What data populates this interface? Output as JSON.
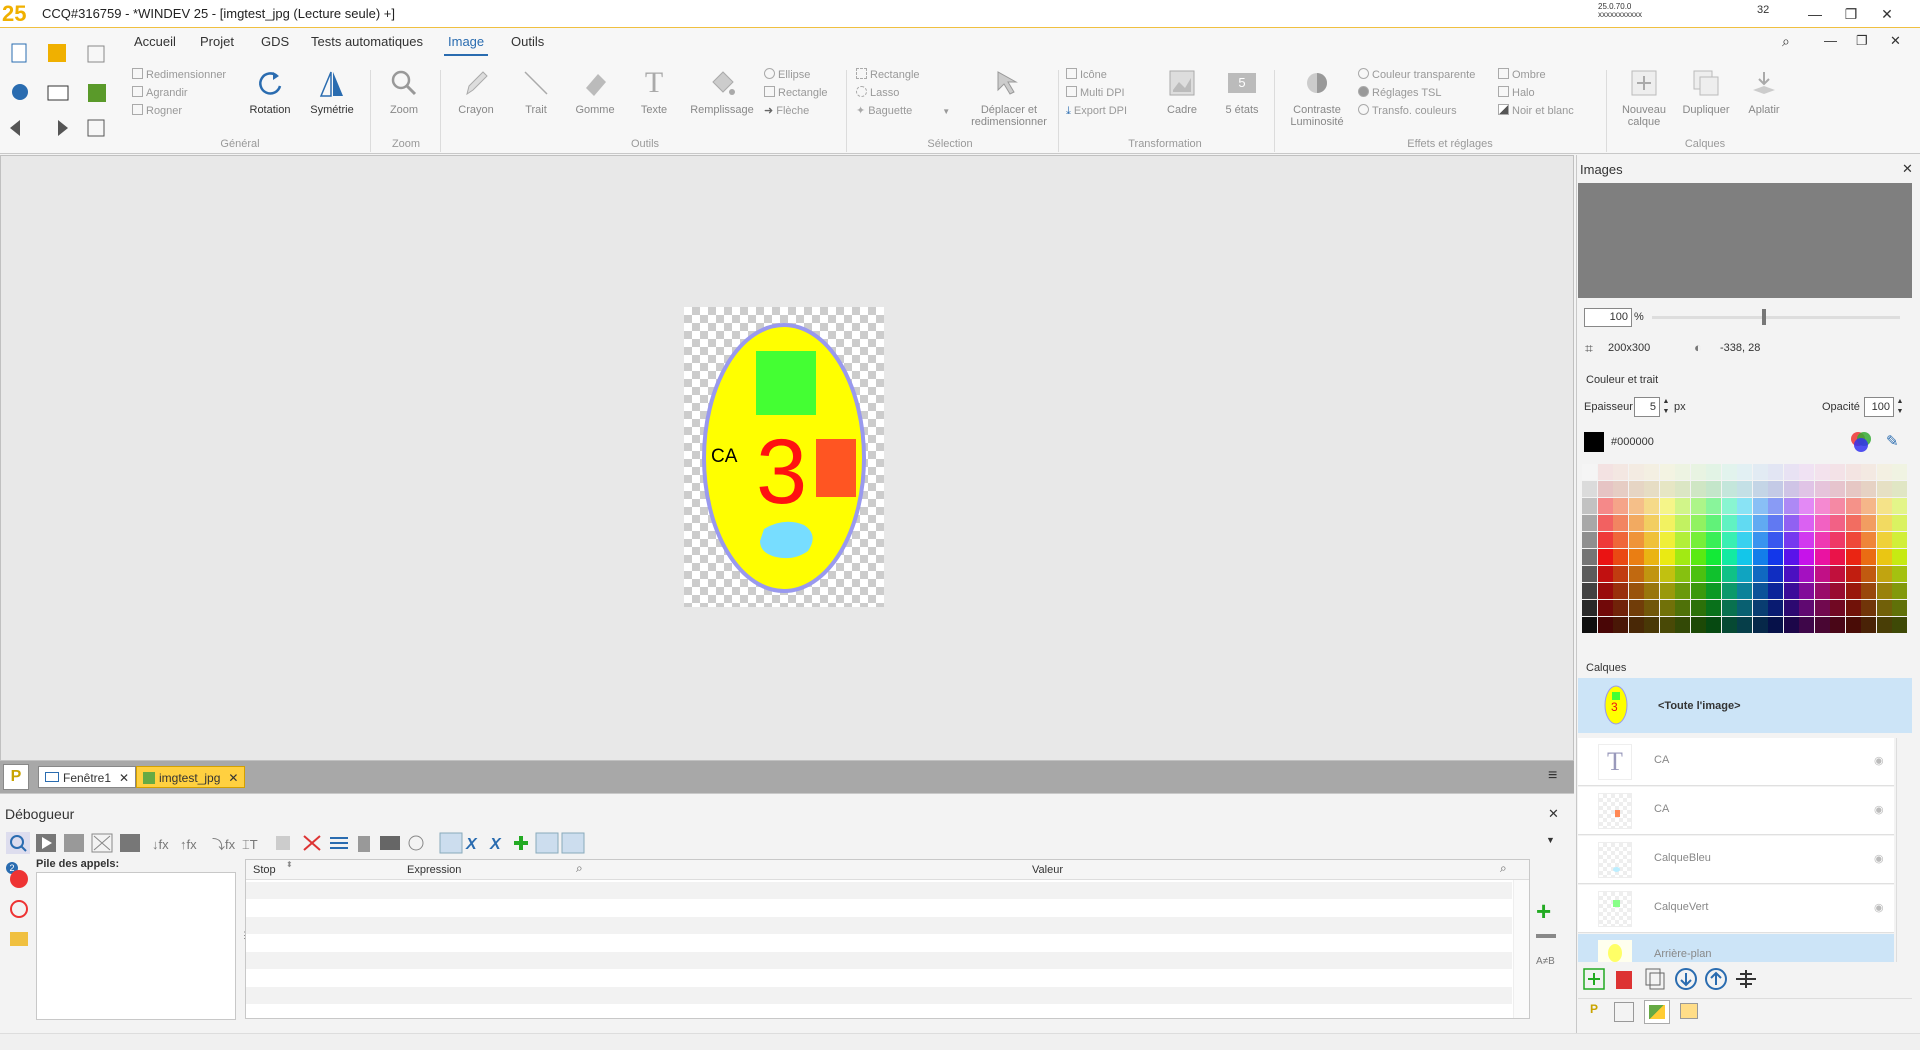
{
  "titlebar": {
    "title": "CCQ#316759 - *WINDEV 25 - [imgtest_jpg (Lecture seule) +]",
    "version_line1": "25.0.70.0",
    "version_line2": "xxxxxxxxxxx",
    "bits": "32",
    "minimize": "—",
    "restore": "❐",
    "close": "✕"
  },
  "ribbon": {
    "tabs": [
      "Accueil",
      "Projet",
      "GDS",
      "Tests automatiques",
      "Image",
      "Outils"
    ],
    "general": {
      "redim": "Redimensionner",
      "agrandir": "Agrandir",
      "rogner": "Rogner",
      "rotation": "Rotation",
      "symetrie": "Symétrie",
      "label": "Général"
    },
    "zoom": {
      "zoom": "Zoom",
      "label": "Zoom"
    },
    "outils": {
      "crayon": "Crayon",
      "trait": "Trait",
      "gomme": "Gomme",
      "texte": "Texte",
      "remplissage": "Remplissage",
      "ellipse": "Ellipse",
      "rectangle": "Rectangle",
      "fleche": "Flèche",
      "label": "Outils"
    },
    "selection": {
      "rectangle": "Rectangle",
      "lasso": "Lasso",
      "baguette": "Baguette",
      "deplacer1": "Déplacer et",
      "deplacer2": "redimensionner",
      "label": "Sélection"
    },
    "transformation": {
      "icone": "Icône",
      "multidpi": "Multi DPI",
      "export": "Export DPI",
      "cadre": "Cadre",
      "etats": "5 états",
      "etats_num": "5",
      "label": "Transformation"
    },
    "effets": {
      "contraste1": "Contraste",
      "contraste2": "Luminosité",
      "couleur_transp": "Couleur transparente",
      "reglages": "Réglages TSL",
      "transfo": "Transfo. couleurs",
      "ombre": "Ombre",
      "halo": "Halo",
      "noir_blanc": "Noir et blanc",
      "label": "Effets et réglages"
    },
    "calques": {
      "nouveau1": "Nouveau",
      "nouveau2": "calque",
      "dupliquer": "Dupliquer",
      "aplatir": "Aplatir",
      "label": "Calques"
    }
  },
  "image": {
    "text_ca": "CA",
    "text_3": "3"
  },
  "doc_tabs": [
    {
      "label": "Fenêtre1"
    },
    {
      "label": "imgtest_jpg"
    }
  ],
  "debugger": {
    "title": "Débogueur",
    "callstack_label": "Pile des appels:",
    "columns": [
      "Stop",
      "Expression",
      "Valeur"
    ],
    "badge": "2"
  },
  "right_panel": {
    "title": "Images",
    "zoom_value": "100",
    "zoom_unit": "%",
    "size": "200x300",
    "coords": "-338, 28",
    "color_section": "Couleur et trait",
    "thickness_label": "Epaisseur",
    "thickness_value": "5",
    "thickness_unit": "px",
    "opacity_label": "Opacité",
    "opacity_value": "100",
    "color_hex": "#000000",
    "layers_section": "Calques",
    "layers": [
      {
        "name": "<Toute l'image>",
        "selected": true
      },
      {
        "name": "CA"
      },
      {
        "name": "CA"
      },
      {
        "name": "CalqueBleu"
      },
      {
        "name": "CalqueVert"
      },
      {
        "name": "Arrière-plan"
      }
    ]
  },
  "colors": {
    "accent": "#2a6cb0",
    "brand": "#f0b000",
    "image_yellow": "#ffff00",
    "image_green": "#44ff33",
    "image_red": "#ff1111",
    "image_orange": "#ff5522",
    "image_cyan": "#77ddff",
    "image_border": "#9999ee"
  }
}
